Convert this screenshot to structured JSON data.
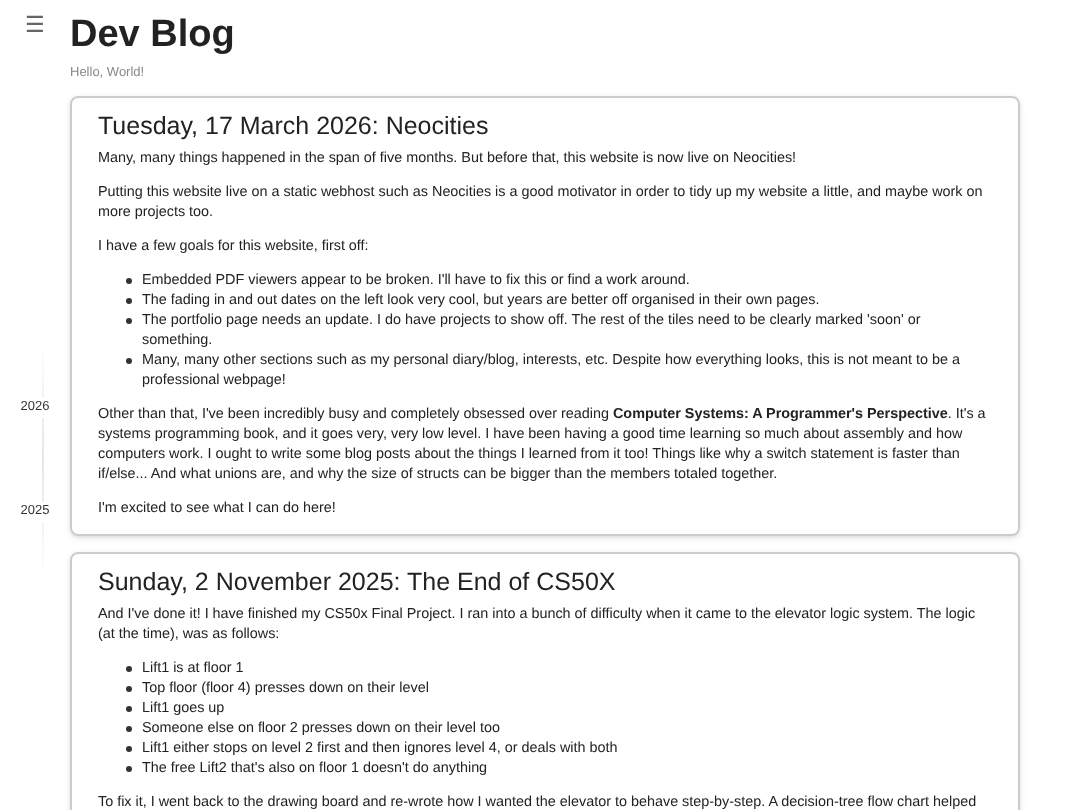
{
  "header": {
    "menu_icon": "☰",
    "title": "Dev Blog",
    "subtitle": "Hello, World!"
  },
  "timeline": {
    "years": [
      "2026",
      "2025"
    ]
  },
  "posts": [
    {
      "title": "Tuesday, 17 March 2026: Neocities",
      "blocks": [
        {
          "kind": "paragraph",
          "text": "Many, many things happened in the span of five months. But before that, this website is now live on Neocities!"
        },
        {
          "kind": "paragraph",
          "text": "Putting this website live on a static webhost such as Neocities is a good motivator in order to tidy up my website a little, and maybe work on more projects too."
        },
        {
          "kind": "paragraph",
          "text": "I have a few goals for this website, first off:"
        },
        {
          "kind": "list",
          "items": [
            "Embedded PDF viewers appear to be broken. I'll have to fix this or find a work around.",
            "The fading in and out dates on the left look very cool, but years are better off organised in their own pages.",
            "The portfolio page needs an update. I do have projects to show off. The rest of the tiles need to be clearly marked 'soon' or something.",
            "Many, many other sections such as my personal diary/blog, interests, etc. Despite how everything looks, this is not meant to be a professional webpage!"
          ]
        },
        {
          "kind": "paragraph",
          "text": "Other than that, I've been incredibly busy and completely obsessed over reading **Computer Systems: A Programmer's Perspective**. It's a systems programming book, and it goes very, very low level. I have been having a good time learning so much about assembly and how computers work. I ought to write some blog posts about the things I learned from it too! Things like why a switch statement is faster than if/else... And what unions are, and why the size of structs can be bigger than the members totaled together."
        },
        {
          "kind": "paragraph",
          "text": "I'm excited to see what I can do here!"
        }
      ]
    },
    {
      "title": "Sunday, 2 November 2025: The End of CS50X",
      "blocks": [
        {
          "kind": "paragraph",
          "text": "And I've done it! I have finished my CS50x Final Project. I ran into a bunch of difficulty when it came to the elevator logic system. The logic (at the time), was as follows:"
        },
        {
          "kind": "list",
          "items": [
            "Lift1 is at floor 1",
            "Top floor (floor 4) presses down on their level",
            "Lift1 goes up",
            "Someone else on floor 2 presses down on their level too",
            "Lift1 either stops on level 2 first and then ignores level 4, or deals with both",
            "The free Lift2 that's also on floor 1 doesn't do anything"
          ]
        },
        {
          "kind": "paragraph",
          "text": "To fix it, I went back to the drawing board and re-wrote how I wanted the elevator to behave step-by-step. A decision-tree flow chart helped"
        }
      ]
    }
  ]
}
